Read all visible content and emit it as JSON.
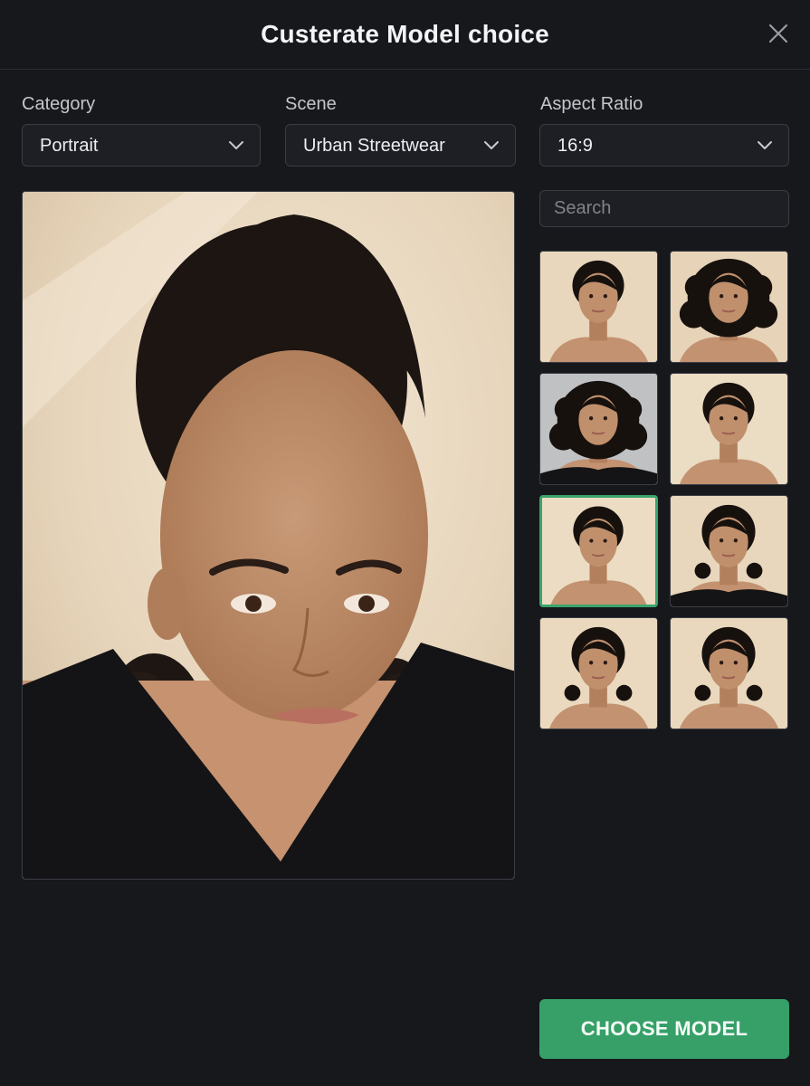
{
  "dialog": {
    "title": "Custerate Model choice"
  },
  "filters": {
    "category": {
      "label": "Category",
      "value": "Portrait"
    },
    "scene": {
      "label": "Scene",
      "value": "Urban Streetwear"
    },
    "aspect_ratio": {
      "label": "Aspect Ratio",
      "value": "16:9"
    }
  },
  "search": {
    "placeholder": "Search",
    "value": ""
  },
  "thumbnails": [
    {
      "hair": "straight-tied",
      "bg": "#e9d7bd",
      "top": "bare",
      "selected": false
    },
    {
      "hair": "curly",
      "bg": "#e6d3b8",
      "top": "bare",
      "selected": false
    },
    {
      "hair": "curly",
      "bg": "#bfc1c3",
      "top": "black",
      "selected": false
    },
    {
      "hair": "straight-tied",
      "bg": "#ebdcc4",
      "top": "bare",
      "selected": false
    },
    {
      "hair": "straight-tied",
      "bg": "#ecdcc3",
      "top": "bare",
      "selected": true
    },
    {
      "hair": "curly-tied",
      "bg": "#e8d7bd",
      "top": "black",
      "selected": false
    },
    {
      "hair": "curly-tied",
      "bg": "#ead9bf",
      "top": "bare",
      "selected": false
    },
    {
      "hair": "curly-tied",
      "bg": "#e9d8be",
      "top": "bare",
      "selected": false
    }
  ],
  "actions": {
    "choose_label": "CHOOSE MODEL"
  },
  "icons": {
    "close": "close-icon",
    "dropdown": "chevron-down-icon"
  },
  "colors": {
    "accent": "#36a068",
    "background": "#17181c",
    "selected_border": "#3aa56b"
  }
}
